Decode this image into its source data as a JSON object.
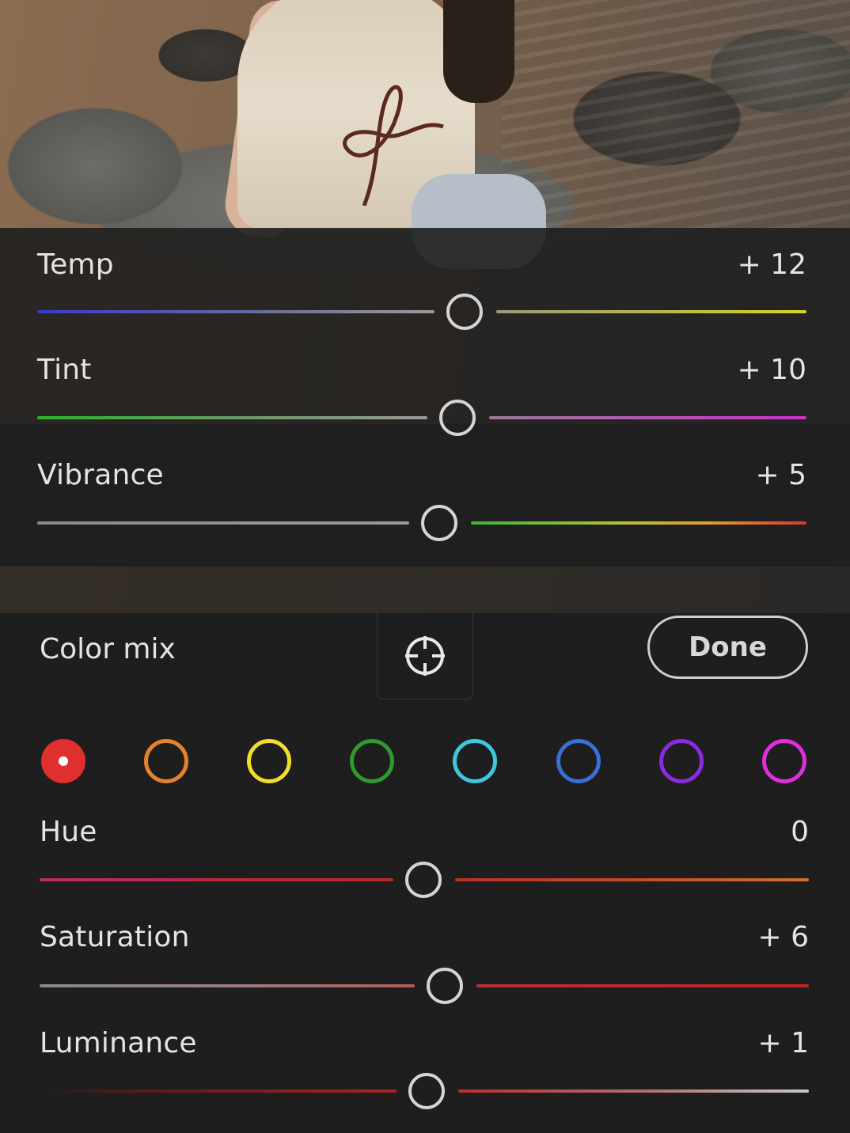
{
  "photo": {
    "description_icon": "beach-photo"
  },
  "light_sliders": [
    {
      "label": "Temp",
      "value": "+ 12",
      "level": 0.56
    },
    {
      "label": "Tint",
      "value": "+ 10",
      "level": 0.55
    },
    {
      "label": "Vibrance",
      "value": "+ 5",
      "level": 0.525
    }
  ],
  "color_mix": {
    "title": "Color mix",
    "target_icon": "crosshair-target-icon",
    "done_label": "Done",
    "swatches": [
      {
        "name": "red",
        "color": "#e0302e",
        "selected": true
      },
      {
        "name": "orange",
        "color": "#e8822a",
        "selected": false
      },
      {
        "name": "yellow",
        "color": "#f1de2c",
        "selected": false
      },
      {
        "name": "green",
        "color": "#2f9a2f",
        "selected": false
      },
      {
        "name": "aqua",
        "color": "#3fc7e0",
        "selected": false
      },
      {
        "name": "blue",
        "color": "#3a6fd6",
        "selected": false
      },
      {
        "name": "purple",
        "color": "#8a2be2",
        "selected": false
      },
      {
        "name": "magenta",
        "color": "#e02ee0",
        "selected": false
      }
    ],
    "sliders": [
      {
        "label": "Hue",
        "value": "0",
        "level": 0.5
      },
      {
        "label": "Saturation",
        "value": "+ 6",
        "level": 0.53
      },
      {
        "label": "Luminance",
        "value": "+ 1",
        "level": 0.505
      }
    ]
  }
}
